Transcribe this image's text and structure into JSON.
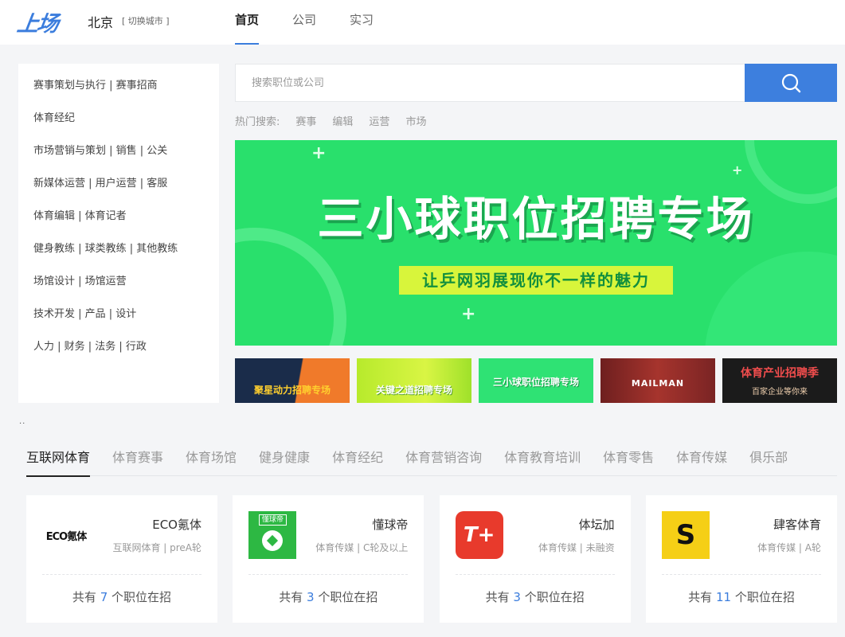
{
  "header": {
    "logo": "上场",
    "city": "北京",
    "city_switch": "[ 切换城市 ]",
    "nav": [
      {
        "label": "首页",
        "active": true
      },
      {
        "label": "公司",
        "active": false
      },
      {
        "label": "实习",
        "active": false
      }
    ]
  },
  "categories": [
    "赛事策划与执行 | 赛事招商",
    "体育经纪",
    "市场营销与策划 | 销售 | 公关",
    "新媒体运营 | 用户运营 | 客服",
    "体育编辑 | 体育记者",
    "健身教练 | 球类教练 | 其他教练",
    "场馆设计 | 场馆运营",
    "技术开发 | 产品 | 设计",
    "人力 | 财务 | 法务 | 行政"
  ],
  "search": {
    "placeholder": "搜索职位或公司",
    "hot_label": "热门搜索:",
    "hot_words": [
      "赛事",
      "编辑",
      "运营",
      "市场"
    ]
  },
  "banner": {
    "title": "三小球职位招聘专场",
    "subtitle": "让乒网羽展现你不一样的魅力"
  },
  "thumbnails": [
    {
      "label": "聚星动力招聘专场"
    },
    {
      "label": "关键之道招聘专场"
    },
    {
      "label": "三小球职位招聘专场"
    },
    {
      "label": "MAILMAN"
    },
    {
      "label": "体育产业招聘季",
      "sub": "百家企业等你来"
    }
  ],
  "dots": "..",
  "industry_tabs": [
    {
      "label": "互联网体育",
      "active": true
    },
    {
      "label": "体育赛事",
      "active": false
    },
    {
      "label": "体育场馆",
      "active": false
    },
    {
      "label": "健身健康",
      "active": false
    },
    {
      "label": "体育经纪",
      "active": false
    },
    {
      "label": "体育营销咨询",
      "active": false
    },
    {
      "label": "体育教育培训",
      "active": false
    },
    {
      "label": "体育零售",
      "active": false
    },
    {
      "label": "体育传媒",
      "active": false
    },
    {
      "label": "俱乐部",
      "active": false
    }
  ],
  "companies": [
    {
      "name": "ECO氪体",
      "meta": "互联网体育 | preA轮",
      "jobs_prefix": "共有",
      "count": "7",
      "jobs_suffix": "个职位在招",
      "logo_text": "ECO氪体"
    },
    {
      "name": "懂球帝",
      "meta": "体育传媒 | C轮及以上",
      "jobs_prefix": "共有",
      "count": "3",
      "jobs_suffix": "个职位在招",
      "logo_text": "懂球帝"
    },
    {
      "name": "体坛加",
      "meta": "体育传媒 | 未融资",
      "jobs_prefix": "共有",
      "count": "3",
      "jobs_suffix": "个职位在招",
      "logo_text": "T+"
    },
    {
      "name": "肆客体育",
      "meta": "体育传媒 | A轮",
      "jobs_prefix": "共有",
      "count": "11",
      "jobs_suffix": "个职位在招",
      "logo_text": "S"
    }
  ]
}
